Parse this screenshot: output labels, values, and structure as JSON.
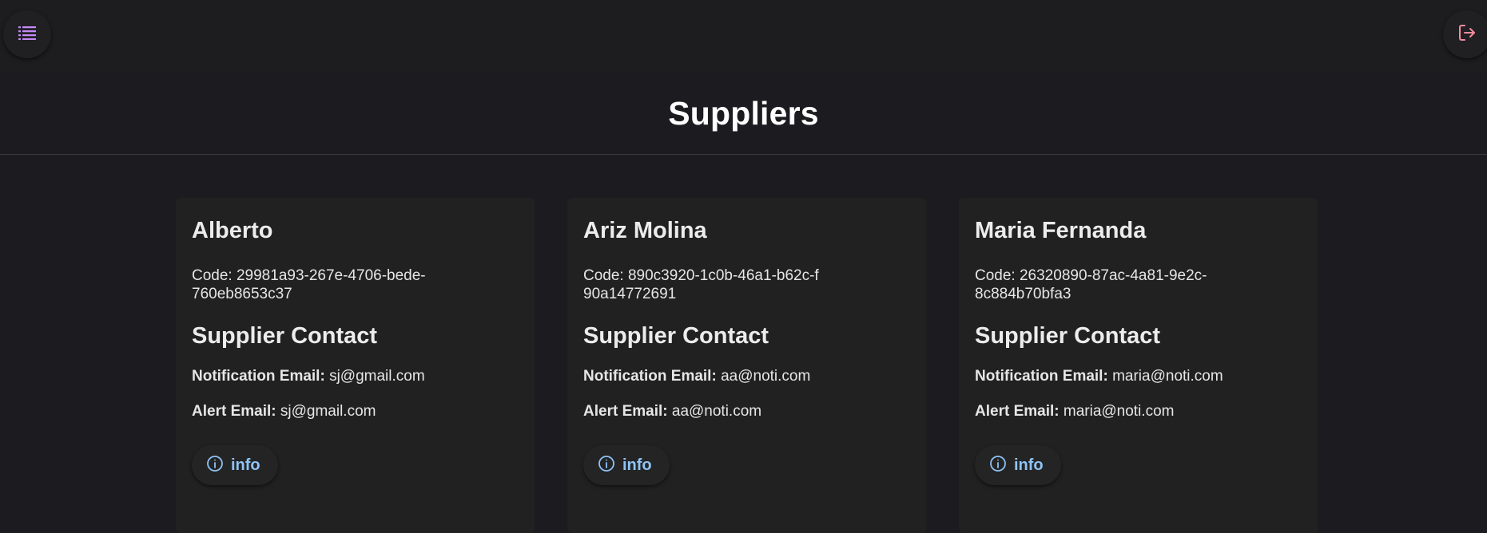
{
  "page": {
    "title": "Suppliers"
  },
  "toolbar": {
    "menu_icon": "list-icon",
    "logout_icon": "logout-icon",
    "menu_color": "#c58af9",
    "logout_color": "#f28b9e"
  },
  "suppliers": [
    {
      "name": "Alberto",
      "code": "Code: 29981a93-267e-4706-bede-760eb8653c37",
      "contact_title": "Supplier Contact",
      "notification_label": "Notification Email:",
      "notification_email": "sj@gmail.com",
      "alert_label": "Alert Email:",
      "alert_email": "sj@gmail.com",
      "info_label": "info"
    },
    {
      "name": "Ariz Molina",
      "code": "Code: 890c3920-1c0b-46a1-b62c-f90a14772691",
      "contact_title": "Supplier Contact",
      "notification_label": "Notification Email:",
      "notification_email": "aa@noti.com",
      "alert_label": "Alert Email:",
      "alert_email": "aa@noti.com",
      "info_label": "info"
    },
    {
      "name": "Maria Fernanda",
      "code": "Code: 26320890-87ac-4a81-9e2c-8c884b70bfa3",
      "contact_title": "Supplier Contact",
      "notification_label": "Notification Email:",
      "notification_email": "maria@noti.com",
      "alert_label": "Alert Email:",
      "alert_email": "maria@noti.com",
      "info_label": "info"
    }
  ]
}
